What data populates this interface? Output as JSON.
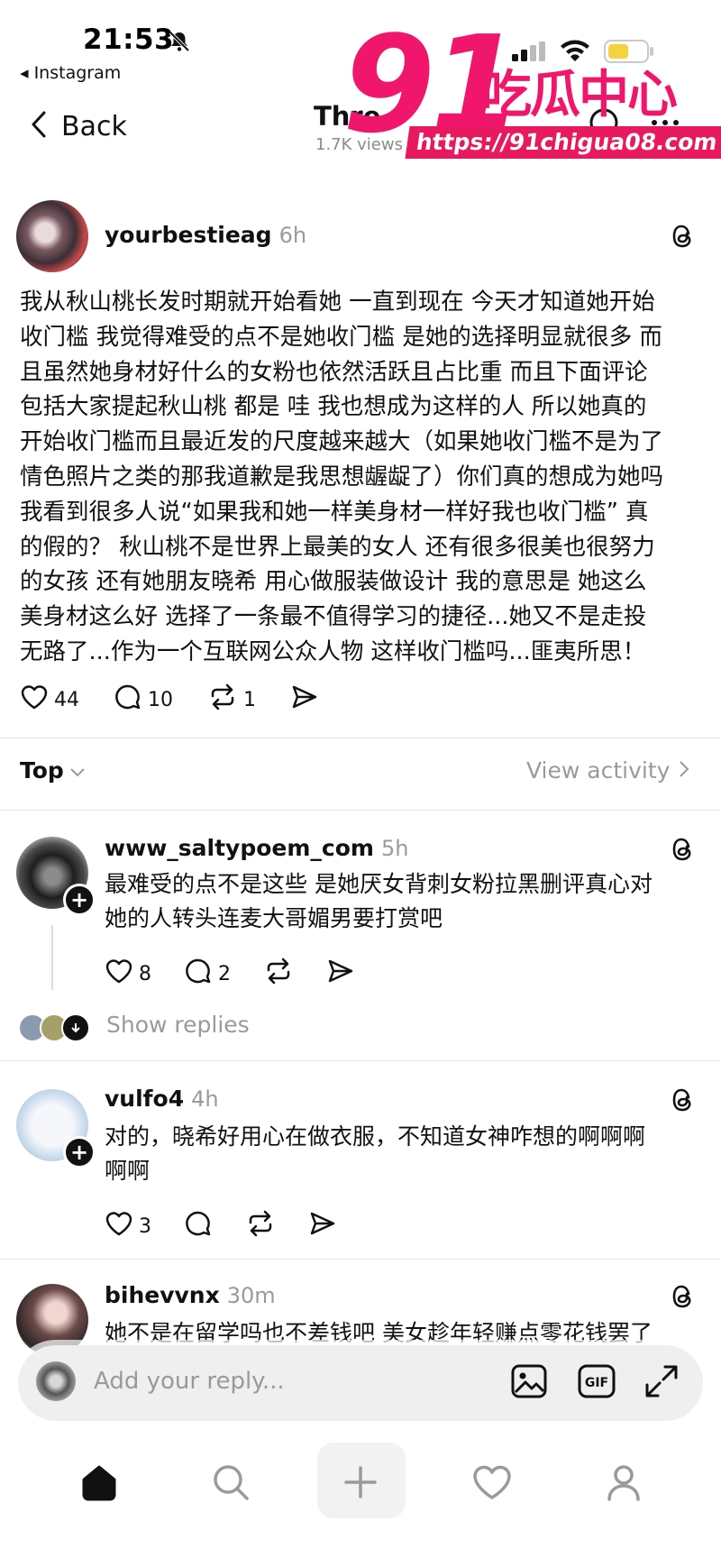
{
  "status_bar": {
    "time": "21:53",
    "back_app": "◂ Instagram"
  },
  "header": {
    "back_label": "Back",
    "title": "Thre",
    "subtitle": "1.7K views"
  },
  "watermark": {
    "big": "91",
    "cn": "吃瓜中心",
    "url": "https://91chigua08.com"
  },
  "post": {
    "username": "yourbestieag",
    "time": "6h",
    "lines": [
      "我从秋山桃长发时期就开始看她 一直到现在 今天才知道她开始",
      "收门槛 我觉得难受的点不是她收门槛 是她的选择明显就很多 而",
      "且虽然她身材好什么的女粉也依然活跃且占比重 而且下面评论",
      "包括大家提起秋山桃 都是 哇 我也想成为这样的人 所以她真的",
      "开始收门槛而且最近发的尺度越来越大（如果她收门槛不是为了",
      "情色照片之类的那我道歉是我思想龌龊了）你们真的想成为她吗",
      "我看到很多人说“如果我和她一样美身材一样好我也收门槛” 真",
      "的假的？ 秋山桃不是世界上最美的女人 还有很多很美也很努力",
      "的女孩 还有她朋友晓希 用心做服装做设计 我的意思是 她这么",
      "美身材这么好 选择了一条最不值得学习的捷径...她又不是走投",
      "无路了...作为一个互联网公众人物 这样收门槛吗...匪夷所思！"
    ],
    "likes": "44",
    "comments": "10",
    "reposts": "1"
  },
  "sort": {
    "label": "Top",
    "view_activity": "View activity"
  },
  "replies": [
    {
      "username": "www_saltypoem_com",
      "time": "5h",
      "lines": [
        "最难受的点不是这些 是她厌女背刺女粉拉黑删评真心对",
        "她的人转头连麦大哥媚男要打赏吧"
      ],
      "likes": "8",
      "comments": "2",
      "show_replies": "Show replies"
    },
    {
      "username": "vulfo4",
      "time": "4h",
      "lines": [
        "对的，晓希好用心在做衣服，不知道女神咋想的啊啊啊",
        "啊啊"
      ],
      "likes": "3"
    },
    {
      "username": "bihevvnx",
      "time": "30m",
      "lines": [
        "她不是在留学吗也不差钱吧 美女趁年轻赚点零花钱罢了"
      ]
    }
  ],
  "reply_bar": {
    "placeholder": "Add your reply...",
    "gif_label": "GIF"
  },
  "icons": [
    "bell-muted-icon",
    "signal-icon",
    "wifi-icon",
    "battery-icon",
    "chevron-left-icon",
    "threads-icon",
    "heart-icon",
    "comment-icon",
    "repost-icon",
    "share-icon",
    "chevron-down-icon",
    "chevron-right-icon",
    "image-icon",
    "gif-icon",
    "expand-icon",
    "home-icon",
    "search-icon",
    "plus-icon",
    "activity-heart-icon",
    "profile-icon"
  ],
  "colors": {
    "watermark": "#f0166c",
    "battery": "#f5d33b",
    "muted_text": "#9a9a9a"
  }
}
